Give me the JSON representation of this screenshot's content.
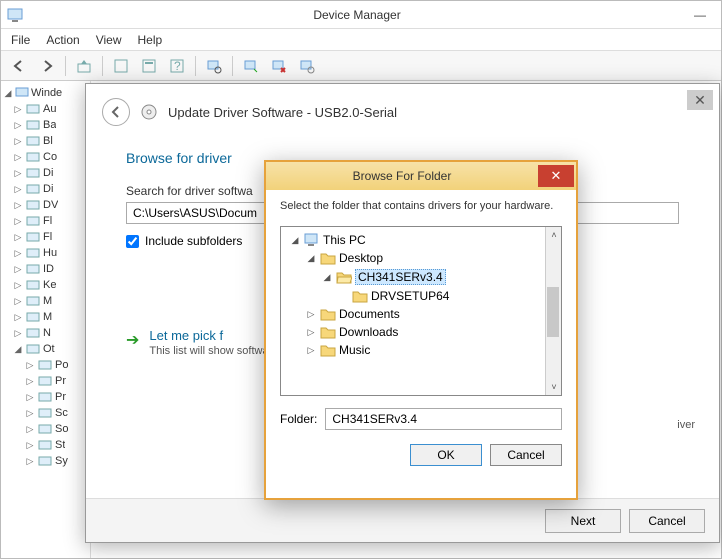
{
  "dm": {
    "title": "Device Manager",
    "menu": {
      "file": "File",
      "action": "Action",
      "view": "View",
      "help": "Help"
    },
    "tree": {
      "root": "Winde",
      "items": [
        "Au",
        "Ba",
        "Bl",
        "Co",
        "Di",
        "Di",
        "DV",
        "Fl",
        "Fl",
        "Hu",
        "ID",
        "Ke",
        "M",
        "M",
        "N",
        "Ot"
      ],
      "sub_items": [
        "Po",
        "Pr",
        "Pr",
        "Sc",
        "So",
        "St",
        "Sy"
      ]
    }
  },
  "wizard": {
    "title": "Update Driver Software - USB2.0-Serial",
    "heading": "Browse for driver",
    "search_label": "Search for driver softwa",
    "path_value": "C:\\Users\\ASUS\\Docum",
    "include_subfolders": "Include subfolders",
    "link_title": "Let me pick f",
    "link_desc": "This list will show\nsoftware in the sa",
    "iver_fragment": "iver",
    "next": "Next",
    "cancel": "Cancel"
  },
  "bff": {
    "title": "Browse For Folder",
    "instruction": "Select the folder that contains drivers for your hardware.",
    "tree": {
      "this_pc": "This PC",
      "desktop": "Desktop",
      "selected": "CH341SERv3.4",
      "drvsetup": "DRVSETUP64",
      "documents": "Documents",
      "downloads": "Downloads",
      "music": "Music"
    },
    "folder_label": "Folder:",
    "folder_value": "CH341SERv3.4",
    "ok": "OK",
    "cancel": "Cancel"
  }
}
